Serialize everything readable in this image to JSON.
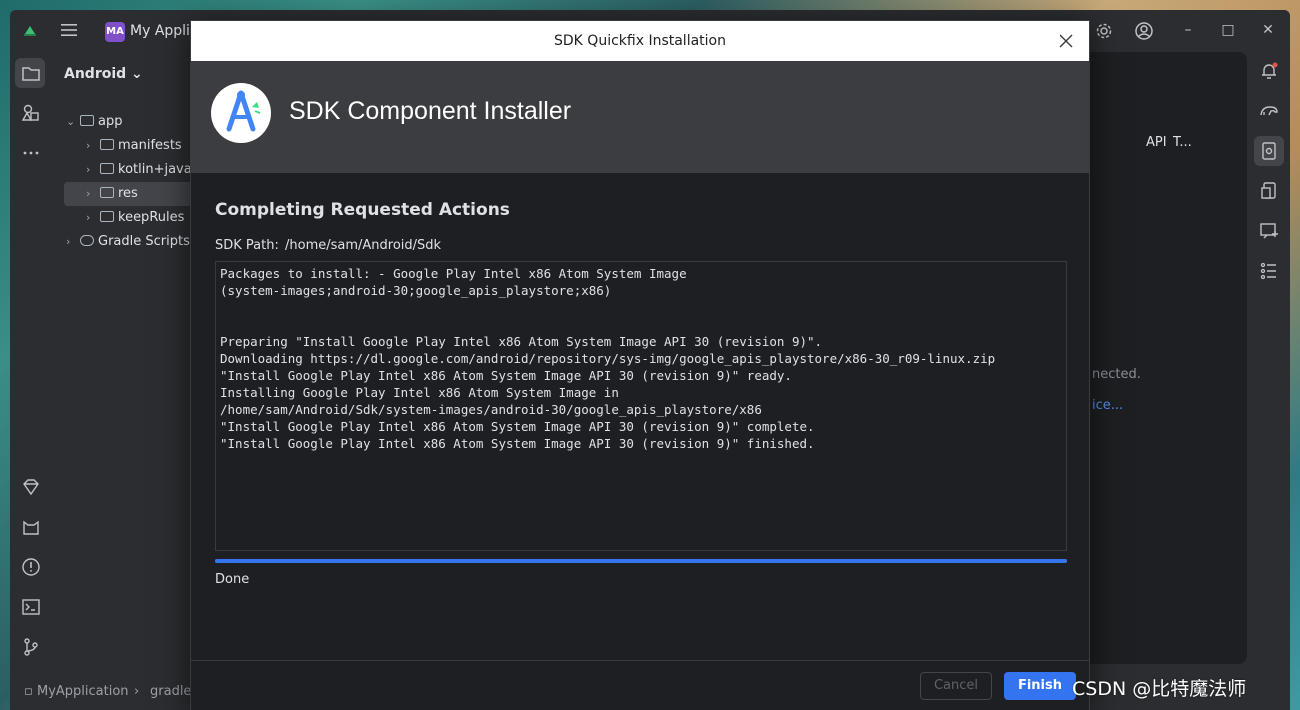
{
  "ide": {
    "project_badge": "MA",
    "project_name": "My Applic",
    "panel_title": "Android",
    "tree": [
      {
        "label": "app",
        "indent": 1,
        "selected": false
      },
      {
        "label": "manifests",
        "indent": 2,
        "selected": false
      },
      {
        "label": "kotlin+java",
        "indent": 2,
        "selected": false
      },
      {
        "label": "res",
        "indent": 2,
        "selected": true
      },
      {
        "label": "keepRules",
        "indent": 2,
        "selected": false
      },
      {
        "label": "Gradle Scripts",
        "indent": 1,
        "selected": false
      }
    ],
    "editor_headers": [
      "API",
      "T..."
    ],
    "editor_note": "nected.",
    "editor_link": "ice...",
    "status_path": [
      "MyApplication",
      "gradle"
    ]
  },
  "dialog": {
    "title": "SDK Quickfix Installation",
    "header_title": "SDK Component Installer",
    "section_title": "Completing Requested Actions",
    "sdk_path_label": "SDK Path:",
    "sdk_path_value": "/home/sam/Android/Sdk",
    "log_lines": [
      "Packages to install: - Google Play Intel x86 Atom System Image",
      "(system-images;android-30;google_apis_playstore;x86)",
      "",
      "",
      "Preparing \"Install Google Play Intel x86 Atom System Image API 30 (revision 9)\".",
      "Downloading https://dl.google.com/android/repository/sys-img/google_apis_playstore/x86-30_r09-linux.zip",
      "\"Install Google Play Intel x86 Atom System Image API 30 (revision 9)\" ready.",
      "Installing Google Play Intel x86 Atom System Image in",
      "/home/sam/Android/Sdk/system-images/android-30/google_apis_playstore/x86",
      "\"Install Google Play Intel x86 Atom System Image API 30 (revision 9)\" complete.",
      "\"Install Google Play Intel x86 Atom System Image API 30 (revision 9)\" finished."
    ],
    "progress_percent": 100,
    "status_text": "Done",
    "cancel_label": "Cancel",
    "finish_label": "Finish"
  },
  "watermark": "CSDN @比特魔法师",
  "colors": {
    "accent": "#3574f0",
    "dialog_bg": "#1e1f22",
    "header_bg": "#3c3d40",
    "ide_bg": "#2b2d30"
  },
  "icons": {
    "titlebar": [
      "android-studio-logo-icon",
      "hamburger-menu-icon",
      "settings-gear-icon",
      "account-icon"
    ],
    "left_toolbar": [
      "project-folder-icon",
      "resource-manager-icon",
      "more-dots-icon",
      "gem-icon",
      "cat-icon",
      "problems-icon",
      "terminal-icon",
      "git-branch-icon"
    ],
    "right_toolbar": [
      "notifications-bell-icon",
      "gradle-elephant-icon",
      "device-manager-icon",
      "device-explorer-icon",
      "running-devices-icon",
      "structure-list-icon"
    ]
  }
}
